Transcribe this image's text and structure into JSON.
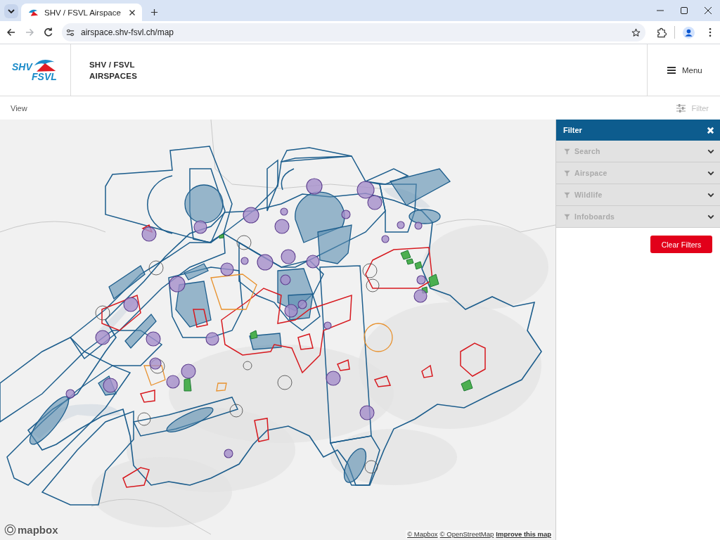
{
  "browser": {
    "tab": {
      "title": "SHV / FSVL Airspace",
      "selected": true
    },
    "nav": [
      {
        "kind": "back",
        "disabled": false
      },
      {
        "kind": "forward",
        "disabled": true
      },
      {
        "kind": "reload",
        "disabled": false
      }
    ],
    "url": "airspace.shv-fsvl.ch/map"
  },
  "header": {
    "logo": {
      "top": "SHV",
      "bottom": "FSVL"
    },
    "title_lines": [
      "SHV / FSVL",
      "AIRSPACES"
    ],
    "menu": {
      "label": "Menu"
    }
  },
  "toolbar": {
    "view": "View",
    "filter": {
      "label": "Filter",
      "disabled": true
    }
  },
  "filter_panel": {
    "title": "Filter",
    "sections": [
      {
        "label": "Search",
        "expanded": false
      },
      {
        "label": "Airspace",
        "expanded": false
      },
      {
        "label": "Wildlife",
        "expanded": false
      },
      {
        "label": "Infoboards",
        "expanded": false
      }
    ],
    "clear_button": "Clear Filters"
  },
  "map": {
    "logo": "mapbox",
    "attribution": [
      {
        "label": "© Mapbox",
        "kind": "credit"
      },
      {
        "label": "© OpenStreetMap",
        "kind": "credit"
      },
      {
        "label": "Improve this map",
        "kind": "feedback"
      }
    ]
  }
}
